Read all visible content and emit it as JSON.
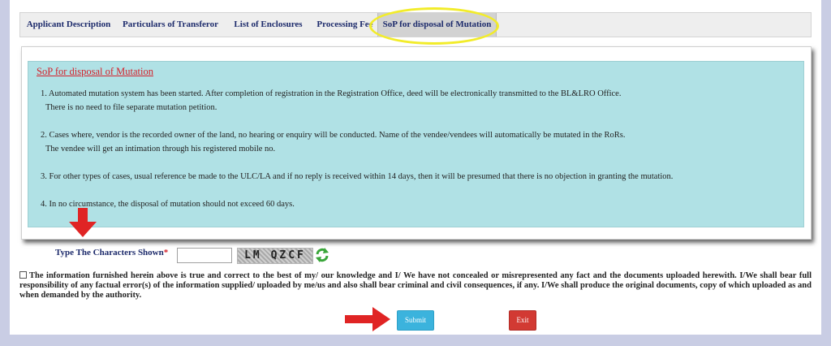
{
  "tabs": [
    {
      "label": "Applicant Description"
    },
    {
      "label": "Particulars of Transferor"
    },
    {
      "label": "List of Enclosures"
    },
    {
      "label": "Processing Fee"
    },
    {
      "label": "SoP for disposal of Mutation"
    }
  ],
  "active_tab": 4,
  "sop": {
    "title": "SoP for disposal of Mutation",
    "points": [
      {
        "line1": "1. Automated mutation system has been started. After completion of registration in the Registration Office, deed will be electronically transmitted to the BL&LRO Office.",
        "line2": "There is no need to file separate mutation petition."
      },
      {
        "line1": "2. Cases where, vendor is the recorded owner of the land, no hearing or enquiry will be conducted. Name of the vendee/vendees will automatically be mutated in the RoRs.",
        "line2": "The vendee will get an intimation through his registered mobile no."
      },
      {
        "line1": "3. For other types of cases, usual reference be made to the ULC/LA and if no reply is received within 14 days, then it will be presumed that there is no objection in granting the mutation."
      },
      {
        "line1": "4. In no circumstance, the disposal of mutation should not exceed 60 days."
      }
    ]
  },
  "captcha": {
    "label": "Type The Characters Shown",
    "required_mark": "*",
    "value": "",
    "image_text": "LM QZCF"
  },
  "declaration": {
    "checked": false,
    "text": "The information furnished herein above is true and correct to the best of my/ our knowledge and I/ We have not concealed or misrepresented any fact and the documents uploaded herewith. I/We shall bear full responsibility of any factual error(s) of the information supplied/ uploaded by me/us and also shall bear criminal and civil consequences, if any. I/We shall produce the original documents, copy of which uploaded as and when demanded by the authority."
  },
  "buttons": {
    "submit": "Submit",
    "exit": "Exit"
  },
  "colors": {
    "tab_text": "#1c2a6b",
    "panel_bg": "#b0e1e5",
    "title_red": "#d4202a",
    "submit_bg": "#3bb3dd",
    "exit_bg": "#d23a33",
    "annotation_arrow": "#e02424",
    "annotation_ring": "#f2ec2a"
  }
}
